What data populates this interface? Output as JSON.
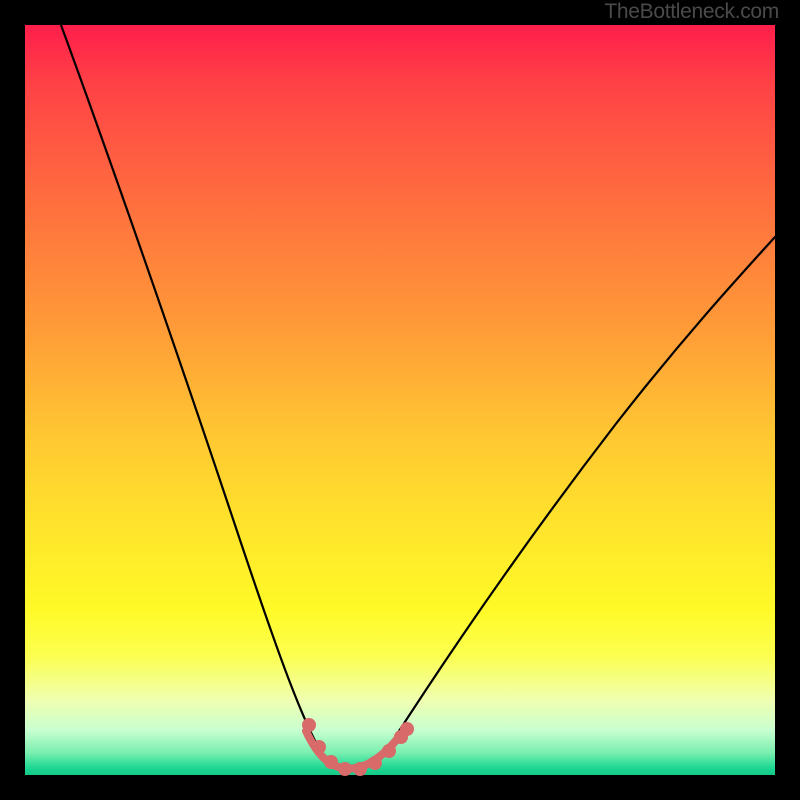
{
  "watermark": "TheBottleneck.com",
  "colors": {
    "background_black": "#000000",
    "curve_stroke": "#000000",
    "trough_stroke": "#d86a6a",
    "gradient_top": "#ff1e4b",
    "gradient_mid": "#ffe22c",
    "gradient_bottom": "#12c985"
  },
  "chart_data": {
    "type": "line",
    "title": "",
    "xlabel": "",
    "ylabel": "",
    "xlim": [
      0,
      100
    ],
    "ylim": [
      0,
      100
    ],
    "grid": false,
    "legend": false,
    "annotations": [
      "TheBottleneck.com"
    ],
    "series": [
      {
        "name": "bottleneck-v-curve",
        "x": [
          0,
          6,
          12,
          18,
          24,
          30,
          34,
          37,
          39,
          41,
          44,
          47,
          50,
          55,
          62,
          70,
          80,
          90,
          100
        ],
        "y": [
          100,
          84,
          67,
          51,
          36,
          22,
          12,
          5,
          2,
          0.5,
          0.5,
          2,
          5,
          11,
          20,
          31,
          44,
          55,
          65
        ]
      },
      {
        "name": "trough-marker",
        "x": [
          37,
          38.5,
          40,
          41.5,
          43,
          45,
          47,
          49,
          50.5
        ],
        "y": [
          5,
          2.5,
          1,
          0.5,
          0.5,
          0.7,
          1.2,
          2.5,
          4.5
        ]
      }
    ]
  }
}
